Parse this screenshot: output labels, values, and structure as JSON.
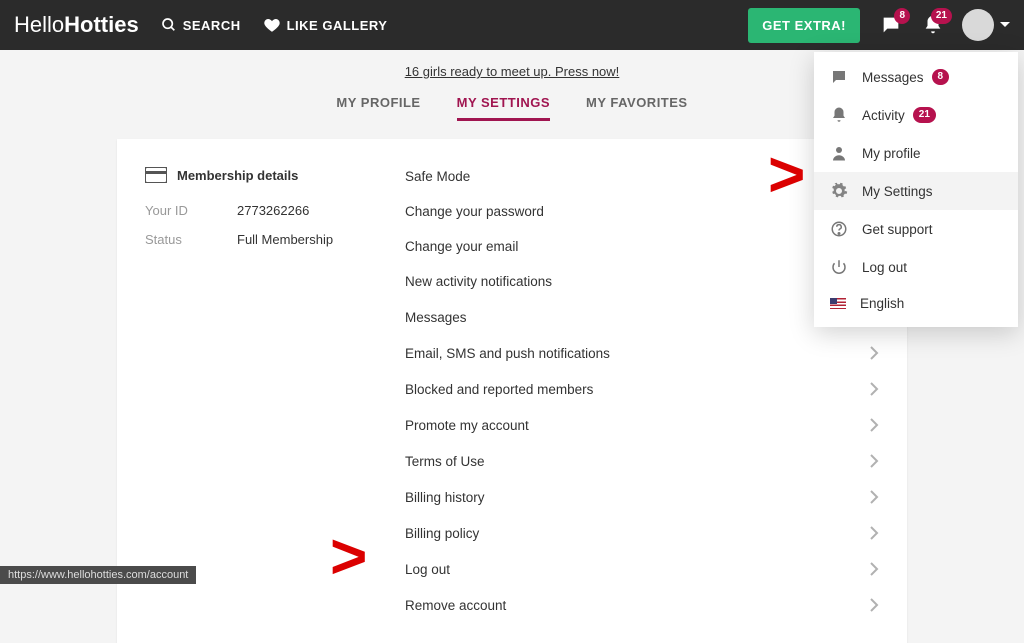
{
  "brand": {
    "a": "Hello",
    "b": "Hotties"
  },
  "nav": {
    "search": "SEARCH",
    "like": "LIKE GALLERY",
    "extra": "GET EXTRA!"
  },
  "badges": {
    "chat": "8",
    "bell": "21"
  },
  "banner": "16 girls ready to meet up. Press now!",
  "tabs": [
    "MY PROFILE",
    "MY SETTINGS",
    "MY FAVORITES"
  ],
  "membership": {
    "title": "Membership details",
    "id_label": "Your ID",
    "id_value": "2773262266",
    "status_label": "Status",
    "status_value": "Full Membership"
  },
  "settings": [
    {
      "label": "Safe Mode",
      "arrow": false
    },
    {
      "label": "Change your password",
      "arrow": false
    },
    {
      "label": "Change your email",
      "arrow": false
    },
    {
      "label": "New activity notifications",
      "arrow": false
    },
    {
      "label": "Messages",
      "arrow": true
    },
    {
      "label": "Email, SMS and push notifications",
      "arrow": true
    },
    {
      "label": "Blocked and reported members",
      "arrow": true
    },
    {
      "label": "Promote my account",
      "arrow": true
    },
    {
      "label": "Terms of Use",
      "arrow": true
    },
    {
      "label": "Billing history",
      "arrow": true
    },
    {
      "label": "Billing policy",
      "arrow": true
    },
    {
      "label": "Log out",
      "arrow": true
    },
    {
      "label": "Remove account",
      "arrow": true
    }
  ],
  "menu": [
    {
      "icon": "chat",
      "label": "Messages",
      "badge": "8"
    },
    {
      "icon": "bell",
      "label": "Activity",
      "badge": "21"
    },
    {
      "icon": "user",
      "label": "My profile"
    },
    {
      "icon": "gear",
      "label": "My Settings",
      "selected": true
    },
    {
      "icon": "help",
      "label": "Get support"
    },
    {
      "icon": "power",
      "label": "Log out"
    },
    {
      "icon": "flag",
      "label": "English"
    }
  ],
  "status_url": "https://www.hellohotties.com/account"
}
